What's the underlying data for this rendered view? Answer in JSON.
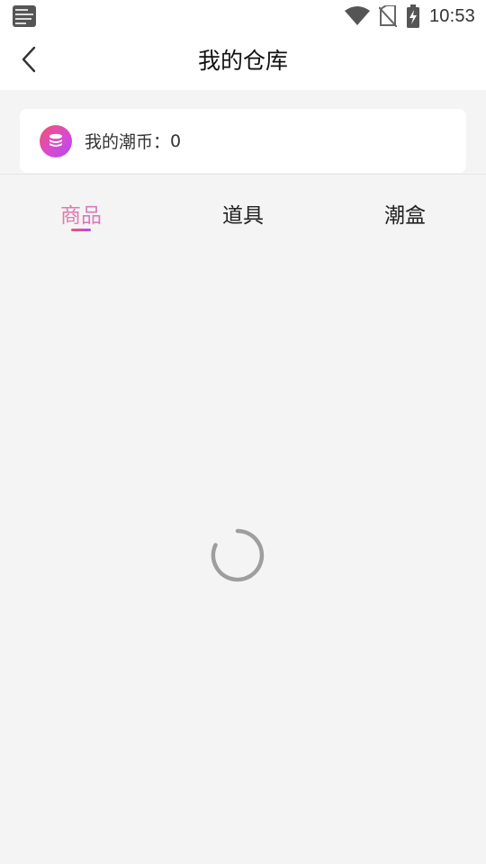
{
  "status_bar": {
    "time": "10:53",
    "icons": [
      "app-notification-icon",
      "wifi-icon",
      "no-sim-icon",
      "battery-charging-icon"
    ]
  },
  "app_bar": {
    "title": "我的仓库",
    "back_icon": "chevron-left-icon"
  },
  "coin_card": {
    "icon": "coin-stack-icon",
    "label": "我的潮币：",
    "value": "0"
  },
  "tabs": [
    {
      "label": "商品",
      "active": true
    },
    {
      "label": "道具",
      "active": false
    },
    {
      "label": "潮盒",
      "active": false
    }
  ],
  "colors": {
    "accent_start": "#f2546d",
    "accent_end": "#b24af0",
    "background": "#f4f4f4",
    "spinner": "#9e9e9e"
  },
  "loading": {
    "icon": "loading-spinner-icon"
  }
}
